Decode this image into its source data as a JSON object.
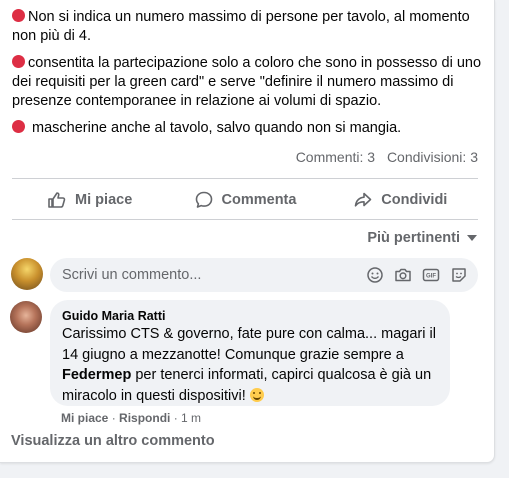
{
  "post": {
    "line1": "Non si indica un numero massimo di persone per tavolo, al momento non più di 4.",
    "line2": "consentita la partecipazione solo a coloro che sono in possesso di uno dei requisiti per la green card\" e serve \"definire il numero massimo di presenze contemporanee in relazione ai volumi di spazio.",
    "line3": " mascherine anche al tavolo, salvo quando non si mangia."
  },
  "stats": {
    "comments": "Commenti: 3",
    "shares": "Condivisioni: 3"
  },
  "actions": {
    "like": "Mi piace",
    "comment": "Commenta",
    "share": "Condividi"
  },
  "sort": {
    "label": "Più pertinenti"
  },
  "composer": {
    "placeholder": "Scrivi un commento..."
  },
  "comment": {
    "author": "Guido Maria Ratti",
    "text_a": "Carissimo CTS & governo, fate pure con calma... magari il 14 giugno a mezzanotte! Comunque grazie sempre a ",
    "mention": "Federmep",
    "text_b": " per tenerci informati, capirci qualcosa è già un miracolo in questi dispositivi! ",
    "like": "Mi piace",
    "reply": "Rispondi",
    "time": "1 m"
  },
  "more": "Visualizza un altro commento",
  "colors": {
    "red_dot": "#dd2e44",
    "muted": "#65676b",
    "bubble": "#f0f2f5"
  }
}
